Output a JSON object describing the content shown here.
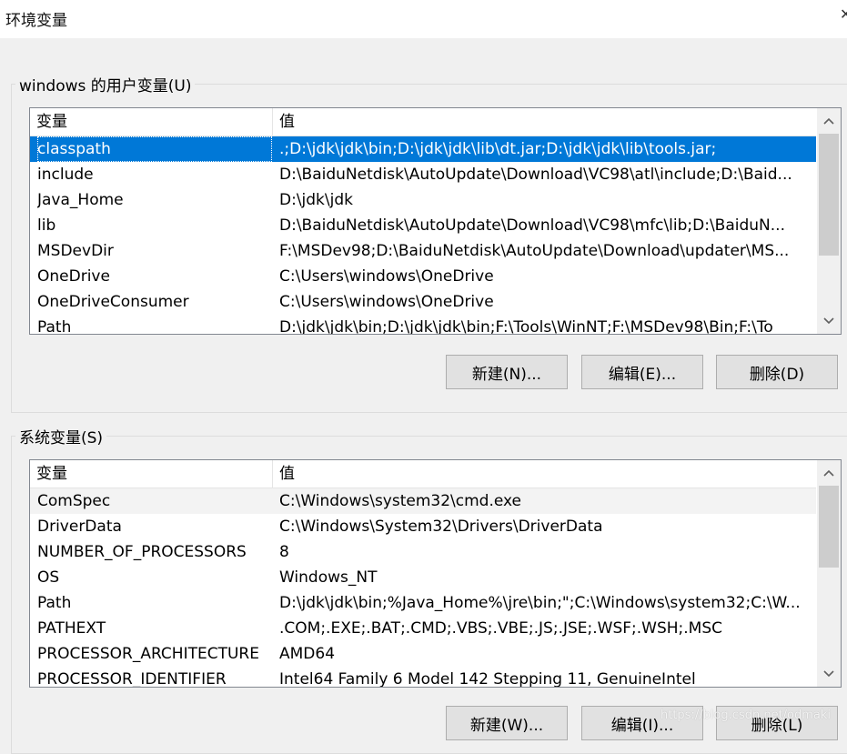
{
  "window": {
    "title": "环境变量",
    "close_glyph": "✕"
  },
  "user_vars": {
    "legend": "windows 的用户变量(U)",
    "columns": [
      "变量",
      "值"
    ],
    "rows": [
      {
        "name": "classpath",
        "value": ".;D:\\jdk\\jdk\\bin;D:\\jdk\\jdk\\lib\\dt.jar;D:\\jdk\\jdk\\lib\\tools.jar;"
      },
      {
        "name": "include",
        "value": "D:\\BaiduNetdisk\\AutoUpdate\\Download\\VC98\\atl\\include;D:\\Baid..."
      },
      {
        "name": "Java_Home",
        "value": "D:\\jdk\\jdk"
      },
      {
        "name": "lib",
        "value": "D:\\BaiduNetdisk\\AutoUpdate\\Download\\VC98\\mfc\\lib;D:\\BaiduN..."
      },
      {
        "name": "MSDevDir",
        "value": "F:\\MSDev98;D:\\BaiduNetdisk\\AutoUpdate\\Download\\updater\\MS..."
      },
      {
        "name": "OneDrive",
        "value": "C:\\Users\\windows\\OneDrive"
      },
      {
        "name": "OneDriveConsumer",
        "value": "C:\\Users\\windows\\OneDrive"
      },
      {
        "name": "Path",
        "value": "D:\\jdk\\jdk\\bin;D:\\jdk\\jdk\\bin;F:\\Tools\\WinNT;F:\\MSDev98\\Bin;F:\\To"
      }
    ],
    "selected_row": "classpath",
    "buttons": {
      "new": "新建(N)...",
      "edit": "编辑(E)...",
      "delete": "删除(D)"
    }
  },
  "system_vars": {
    "legend": "系统变量(S)",
    "columns": [
      "变量",
      "值"
    ],
    "rows": [
      {
        "name": "ComSpec",
        "value": "C:\\Windows\\system32\\cmd.exe"
      },
      {
        "name": "DriverData",
        "value": "C:\\Windows\\System32\\Drivers\\DriverData"
      },
      {
        "name": "NUMBER_OF_PROCESSORS",
        "value": "8"
      },
      {
        "name": "OS",
        "value": "Windows_NT"
      },
      {
        "name": "Path",
        "value": "D:\\jdk\\jdk\\bin;%Java_Home%\\jre\\bin;\";C:\\Windows\\system32;C:\\W..."
      },
      {
        "name": "PATHEXT",
        "value": ".COM;.EXE;.BAT;.CMD;.VBS;.VBE;.JS;.JSE;.WSF;.WSH;.MSC"
      },
      {
        "name": "PROCESSOR_ARCHITECTURE",
        "value": "AMD64"
      },
      {
        "name": "PROCESSOR_IDENTIFIER",
        "value": "Intel64 Family 6 Model 142 Stepping 11, GenuineIntel"
      }
    ],
    "hover_row": "ComSpec",
    "buttons": {
      "new": "新建(W)...",
      "edit": "编辑(I)...",
      "delete": "删除(L)"
    }
  },
  "watermark": "https://blog.csdn.net/odmaki",
  "colors": {
    "selection": "#0078d7",
    "dialog_bg": "#f0f0f0",
    "button_bg": "#e1e1e1",
    "scroll_thumb": "#cdcdcd"
  },
  "icons": {
    "scroll_up": "chevron-up-icon",
    "scroll_down": "chevron-down-icon",
    "close": "close-icon"
  }
}
